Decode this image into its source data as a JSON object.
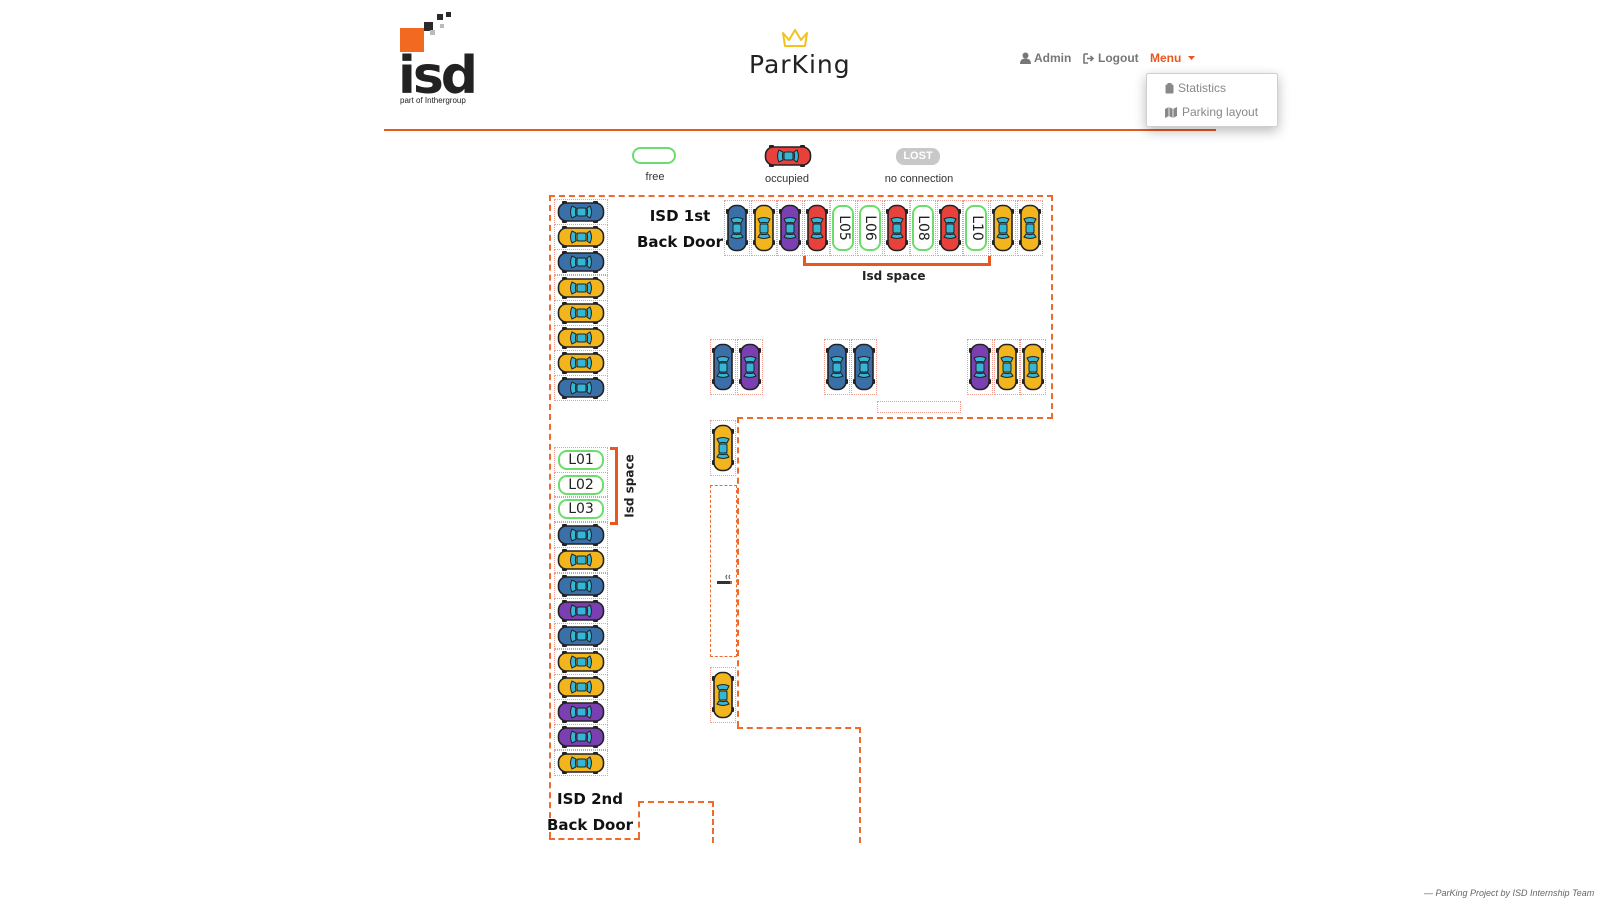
{
  "header": {
    "logo_text": "isd",
    "logo_sub": "part of Inthergroup",
    "brand": "ParKing",
    "nav": {
      "admin": "Admin",
      "logout": "Logout",
      "menu": "Menu"
    },
    "dropdown": [
      {
        "label": "Statistics",
        "icon": "clipboard-icon"
      },
      {
        "label": "Parking layout",
        "icon": "map-icon"
      }
    ]
  },
  "legend": {
    "free": "free",
    "occupied": "occupied",
    "lost_badge": "LOST",
    "no_connection": "no connection"
  },
  "map": {
    "door1_line1": "ISD 1st",
    "door1_line2": "Back Door",
    "door2_line1": "ISD 2nd",
    "door2_line2": "Back Door",
    "isd_space_top": "Isd space",
    "isd_space_left": "Isd space",
    "top_row": [
      {
        "type": "car",
        "color": "navy"
      },
      {
        "type": "car",
        "color": "yellow"
      },
      {
        "type": "car",
        "color": "purple"
      },
      {
        "type": "car",
        "color": "red"
      },
      {
        "type": "free",
        "label": "L05"
      },
      {
        "type": "free",
        "label": "L06"
      },
      {
        "type": "car",
        "color": "red"
      },
      {
        "type": "free",
        "label": "L08"
      },
      {
        "type": "car",
        "color": "red"
      },
      {
        "type": "free",
        "label": "L10"
      },
      {
        "type": "car",
        "color": "yellow"
      },
      {
        "type": "car",
        "color": "yellow"
      }
    ],
    "left_col_a": [
      "navy",
      "yellow",
      "navy",
      "yellow",
      "yellow",
      "yellow",
      "yellow",
      "navy"
    ],
    "left_free": [
      "L01",
      "L02",
      "L03"
    ],
    "left_col_b": [
      "navy",
      "yellow",
      "navy",
      "purple",
      "navy",
      "yellow",
      "yellow",
      "purple",
      "purple",
      "yellow"
    ],
    "mid_a": [
      "navy",
      "purple"
    ],
    "mid_b": [
      "navy",
      "navy"
    ],
    "mid_c": [
      "purple",
      "yellow",
      "yellow"
    ],
    "right_col": [
      "yellow",
      "yellow"
    ]
  },
  "colors": {
    "navy": "#3a6fa8",
    "yellow": "#f2b51d",
    "purple": "#7a3fb0",
    "red": "#e8403a",
    "accent": "#e8571e",
    "free": "#6cdc6c"
  },
  "footer": "— ParKing Project by ISD Internship Team"
}
